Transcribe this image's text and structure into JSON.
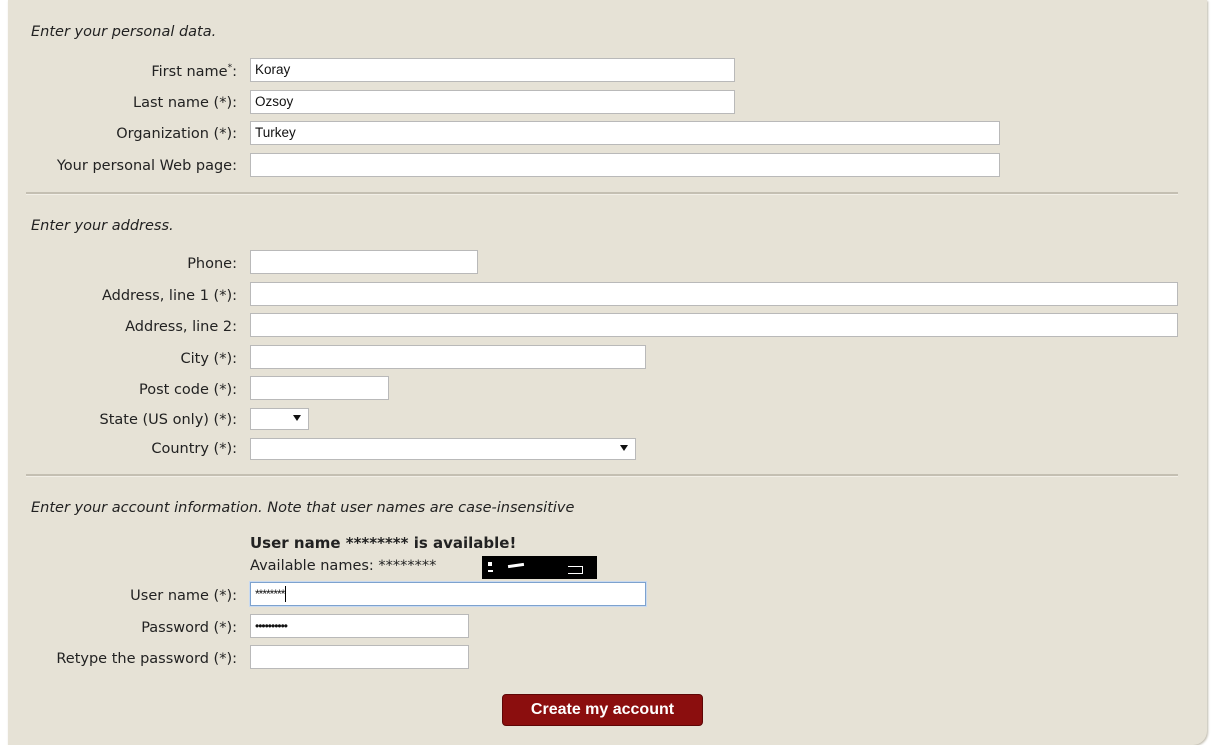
{
  "personal": {
    "heading": "Enter your personal data.",
    "first_name_label": "First name",
    "first_name_mark": "*",
    "first_name_suffix": ":",
    "first_name_value": "Koray",
    "last_name_label": "Last name (*):",
    "last_name_value": "Ozsoy",
    "organization_label": "Organization (*):",
    "organization_value": "Turkey",
    "webpage_label": "Your personal Web page:",
    "webpage_value": ""
  },
  "address": {
    "heading": "Enter your address.",
    "phone_label": "Phone:",
    "address1_label": "Address, line 1 (*):",
    "address2_label": "Address, line 2:",
    "city_label": "City (*):",
    "postcode_label": "Post code (*):",
    "state_label": "State (US only) (*):",
    "country_label": "Country (*):"
  },
  "account": {
    "heading": "Enter your account information. Note that user names are case-insensitive",
    "availability_message": "User name ******** is available!",
    "available_names_label": "Available names: ********",
    "username_label": "User name (*):",
    "username_value": "********",
    "password_label": "Password (*):",
    "password_value": "••••••••••",
    "retype_label": "Retype the password (*):",
    "retype_value": ""
  },
  "submit": {
    "label": "Create my account"
  },
  "colors": {
    "panel": "#e6e2d6",
    "button": "#8b0e0e",
    "focus_border": "#7da2ce"
  }
}
